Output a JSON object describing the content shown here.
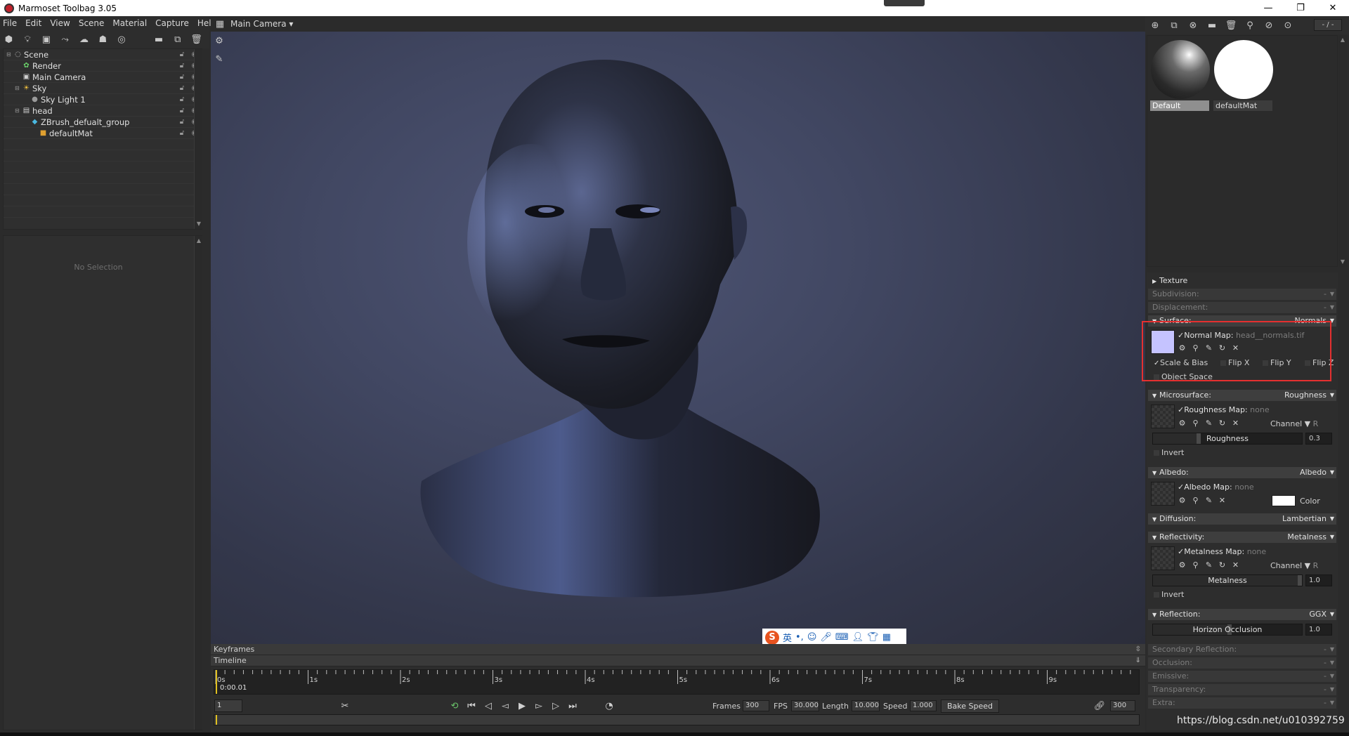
{
  "window": {
    "title": "Marmoset Toolbag 3.05",
    "minimize": "—",
    "maximize": "❐",
    "close": "✕"
  },
  "menu": [
    "File",
    "Edit",
    "View",
    "Scene",
    "Material",
    "Capture",
    "Help"
  ],
  "scene_tree": [
    {
      "label": "Scene",
      "icon": "scene-icon",
      "indent": 0
    },
    {
      "label": "Render",
      "icon": "render-icon",
      "indent": 1
    },
    {
      "label": "Main Camera",
      "icon": "camera-icon",
      "indent": 1
    },
    {
      "label": "Sky",
      "icon": "sky-icon",
      "indent": 1
    },
    {
      "label": "Sky Light 1",
      "icon": "light-icon",
      "indent": 2
    },
    {
      "label": "head",
      "icon": "mesh-icon",
      "indent": 1
    },
    {
      "label": "ZBrush_defualt_group",
      "icon": "group-icon",
      "indent": 2
    },
    {
      "label": "defaultMat",
      "icon": "material-icon",
      "indent": 3
    }
  ],
  "properties": {
    "empty_text": "No Selection"
  },
  "viewport": {
    "camera": "Main Camera"
  },
  "ime": {
    "logo": "S",
    "lang": "英"
  },
  "timeline": {
    "keyframes_label": "Keyframes",
    "timeline_label": "Timeline",
    "ticks": [
      "0s",
      "1s",
      "2s",
      "3s",
      "4s",
      "5s",
      "6s",
      "7s",
      "8s",
      "9s"
    ],
    "time_readout": "0:00.01",
    "frame": "1",
    "frames_label": "Frames",
    "frames": "300",
    "fps_label": "FPS",
    "fps": "30.000",
    "length_label": "Length",
    "length": "10.000",
    "speed_label": "Speed",
    "speed": "1.000",
    "bake_speed": "Bake Speed",
    "end_frame": "300"
  },
  "library": {
    "page": "- / -",
    "materials": [
      {
        "name": "Default",
        "selected": true
      },
      {
        "name": "defaultMat",
        "selected": false
      }
    ]
  },
  "editor": {
    "texture": "Texture",
    "subdivision": {
      "label": "Subdivision:",
      "value": "-"
    },
    "displacement": {
      "label": "Displacement:",
      "value": "-"
    },
    "surface": {
      "label": "Surface:",
      "value": "Normals"
    },
    "normal_map": {
      "label": "Normal Map:",
      "value": "head__normals.tif"
    },
    "scale_bias": "Scale & Bias",
    "flip_x": "Flip X",
    "flip_y": "Flip Y",
    "flip_z": "Flip Z",
    "object_space": "Object Space",
    "microsurface": {
      "label": "Microsurface:",
      "value": "Roughness"
    },
    "roughness_map": {
      "label": "Roughness Map:",
      "value": "none"
    },
    "channel_label": "Channel",
    "channel_r": "R",
    "roughness": {
      "label": "Roughness",
      "value": "0.3"
    },
    "invert": "Invert",
    "albedo": {
      "label": "Albedo:",
      "value": "Albedo"
    },
    "albedo_map": {
      "label": "Albedo Map:",
      "value": "none"
    },
    "color_label": "Color",
    "diffusion": {
      "label": "Diffusion:",
      "value": "Lambertian"
    },
    "reflectivity": {
      "label": "Reflectivity:",
      "value": "Metalness"
    },
    "metalness_map": {
      "label": "Metalness Map:",
      "value": "none"
    },
    "metalness": {
      "label": "Metalness",
      "value": "1.0"
    },
    "reflection": {
      "label": "Reflection:",
      "value": "GGX"
    },
    "horizon": {
      "label": "Horizon Occlusion",
      "value": "1.0"
    },
    "secondary_reflection": {
      "label": "Secondary Reflection:",
      "value": "-"
    },
    "occlusion": {
      "label": "Occlusion:",
      "value": "-"
    },
    "emissive": {
      "label": "Emissive:",
      "value": "-"
    },
    "transparency": {
      "label": "Transparency:",
      "value": "-"
    },
    "extra": {
      "label": "Extra:",
      "value": "-"
    }
  },
  "colors": {
    "normal_swatch": "#c5c3ff",
    "albedo_color": "#ffffff",
    "highlight": "#e53030"
  },
  "watermark": "https://blog.csdn.net/u010392759"
}
